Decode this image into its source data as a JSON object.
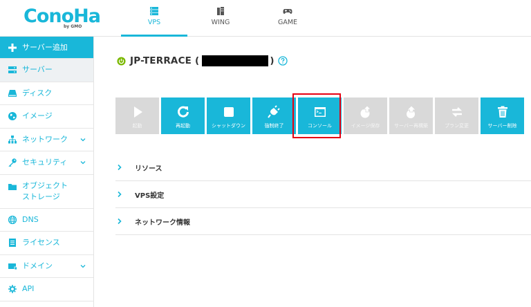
{
  "brand": {
    "logo": "ConoHa",
    "logo_sub": "by GMO",
    "accent": "#19b7d9"
  },
  "header": {
    "tabs": [
      {
        "label": "VPS",
        "icon": "server-stack-icon",
        "active": true
      },
      {
        "label": "WING",
        "icon": "building-icon",
        "active": false
      },
      {
        "label": "GAME",
        "icon": "gamepad-icon",
        "active": false
      }
    ]
  },
  "sidebar": {
    "items": [
      {
        "label": "サーバー追加",
        "icon": "plus-icon"
      },
      {
        "label": "サーバー",
        "icon": "server-icon"
      },
      {
        "label": "ディスク",
        "icon": "disk-icon"
      },
      {
        "label": "イメージ",
        "icon": "globe-icon"
      },
      {
        "label": "ネットワーク",
        "icon": "network-icon",
        "expandable": true
      },
      {
        "label": "セキュリティ",
        "icon": "key-icon",
        "expandable": true
      },
      {
        "label": "オブジェクト\nストレージ",
        "label_line1": "オブジェクト",
        "label_line2": "ストレージ",
        "icon": "folder-icon"
      },
      {
        "label": "DNS",
        "icon": "globe-grid-icon"
      },
      {
        "label": "ライセンス",
        "icon": "document-icon"
      },
      {
        "label": "ドメイン",
        "icon": "domain-icon",
        "expandable": true
      },
      {
        "label": "API",
        "icon": "api-icon"
      }
    ]
  },
  "main": {
    "server_name_prefix": "JP-TERRACE (",
    "server_name_suffix": ")",
    "status_color": "#7ab800",
    "actions": [
      {
        "label": "起動",
        "icon": "play-icon",
        "enabled": false
      },
      {
        "label": "再起動",
        "icon": "restart-icon",
        "enabled": true
      },
      {
        "label": "シャットダウン",
        "icon": "stop-icon",
        "enabled": true
      },
      {
        "label": "強制終了",
        "icon": "force-stop-icon",
        "enabled": true
      },
      {
        "label": "コンソール",
        "icon": "console-icon",
        "enabled": true,
        "highlighted": true
      },
      {
        "label": "イメージ保存",
        "icon": "image-save-icon",
        "enabled": false
      },
      {
        "label": "サーバー再構築",
        "icon": "rebuild-icon",
        "enabled": false
      },
      {
        "label": "プラン変更",
        "icon": "plan-change-icon",
        "enabled": false
      },
      {
        "label": "サーバー削除",
        "icon": "trash-icon",
        "enabled": true
      }
    ],
    "sections": [
      {
        "label": "リソース"
      },
      {
        "label": "VPS設定"
      },
      {
        "label": "ネットワーク情報"
      }
    ]
  }
}
